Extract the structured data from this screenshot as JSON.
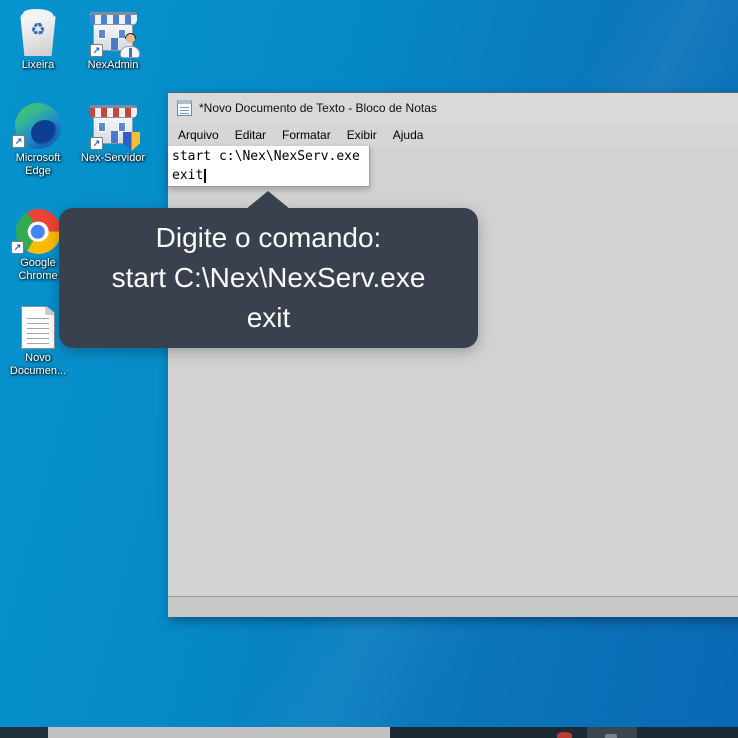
{
  "desktop": {
    "icons": [
      {
        "label": "Lixeira"
      },
      {
        "label": "NexAdmin"
      },
      {
        "label": "Microsoft Edge"
      },
      {
        "label": "Nex-Servidor"
      },
      {
        "label": "Google Chrome"
      },
      {
        "label": "Novo Documen..."
      }
    ]
  },
  "notepad": {
    "title": "*Novo Documento de Texto - Bloco de Notas",
    "menus": [
      "Arquivo",
      "Editar",
      "Formatar",
      "Exibir",
      "Ajuda"
    ],
    "editor": {
      "line1": "start c:\\Nex\\NexServ.exe",
      "line2": "exit"
    }
  },
  "tooltip": {
    "line1": "Digite o comando:",
    "line2": "start C:\\Nex\\NexServ.exe",
    "line3": "exit"
  },
  "colors": {
    "desktop-left": "#0794ce",
    "desktop-right": "#0a68b4",
    "tooltip-bg": "#3a414e",
    "titlebar-bg": "#d9d9d9",
    "content-bg": "#d2d2d2",
    "taskbar-bg": "#1c2a34"
  }
}
